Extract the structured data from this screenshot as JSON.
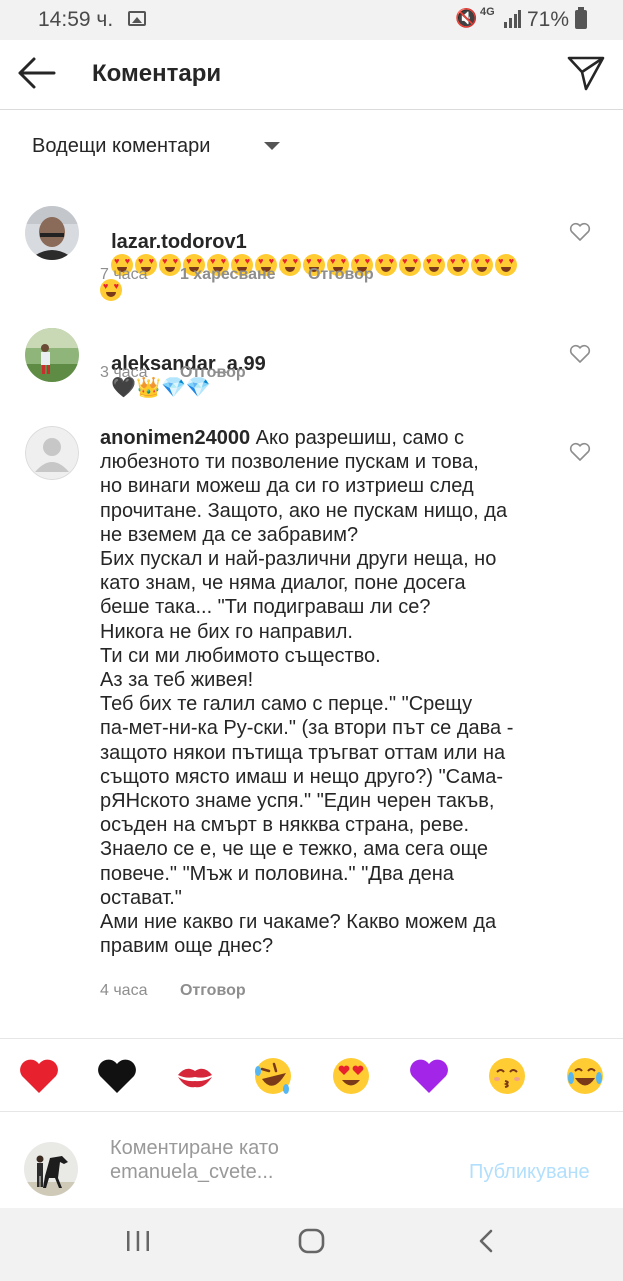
{
  "status_bar": {
    "time": "14:59 ч.",
    "network": "4G",
    "battery": "71%"
  },
  "header": {
    "title": "Коментари"
  },
  "sort": {
    "label": "Водещи коментари"
  },
  "comments": [
    {
      "username": "lazar.todorov1",
      "emoji_count": 18,
      "time": "7 часа",
      "likes": "1 харесване",
      "reply": "Отговор"
    },
    {
      "username": "aleksandar_a.99",
      "time": "3 часа",
      "reply": "Отговор"
    },
    {
      "username": "anonimen24000",
      "text": " Ако разрешиш, само с\nлюбезното ти позволение пускам и това,\nно винаги можеш да си го изтриеш след\nпрочитане. Защото, ако не пускам нищо, да\nне вземем да се забравим?\nБих пускал и най-различни други неща, но\nкато знам, че няма диалог, поне досега\nбеше така... \"Ти подиграваш ли се?\nНикога не бих го направил.\nТи си ми любимото същество.\nАз за теб живея!\nТеб бих те галил само с перце.\" \"Срещу\nпа-мет-ни-ка Ру-ски.\" (за втори път се дава -\nзащото някои пътища тръгват оттам или на\nсъщото място имаш и нещо друго?) \"Сама-\nрЯНското знаме успя.\" \"Един черен такъв,\nосъден на смърт в някква страна, реве.\nЗнаело се е, че ще е тежко, ама сега още\nповече.\" \"Мъж и половина.\" \"Два дена\nостават.\"\nАми ние какво ги чакаме? Какво можем да\nправим още днес?",
      "time": "4 часа",
      "reply": "Отговор"
    }
  ],
  "reactions": [
    "red-heart",
    "black-heart",
    "kiss-mark",
    "rolling-laughing-face",
    "heart-eyes-face",
    "purple-heart",
    "kissing-face",
    "tears-of-joy-face"
  ],
  "composer": {
    "placeholder": "Коментиране като emanuela_cvete...",
    "placeholder_line1": "Коментиране като",
    "placeholder_line2": "emanuela_cvete...",
    "publish": "Публикуване"
  },
  "colors": {
    "accent_blue_disabled": "#b2dffc",
    "meta_gray": "#8e8e8e",
    "heart_red": "#e8212f"
  }
}
